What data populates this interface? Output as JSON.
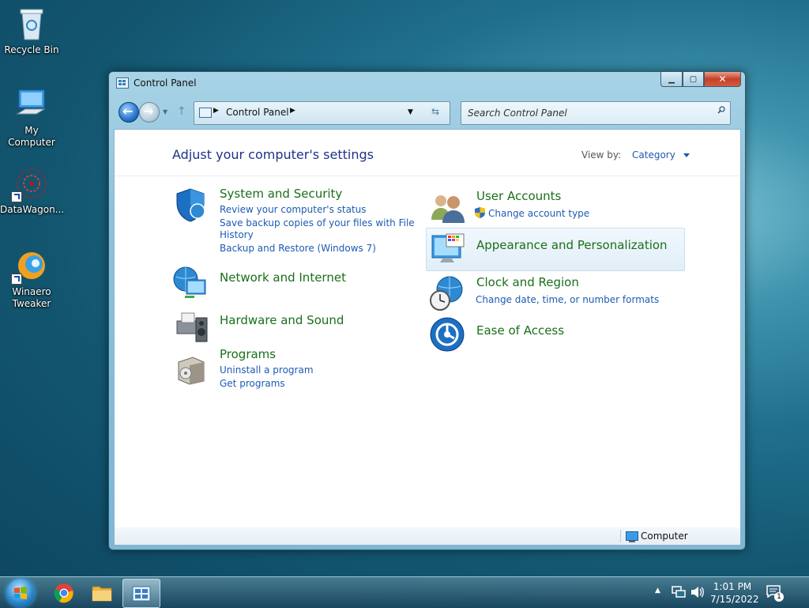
{
  "desktop": {
    "icons": [
      {
        "label": "Recycle Bin"
      },
      {
        "label": "My Computer"
      },
      {
        "label": "DataWagon..."
      },
      {
        "label": "Winaero Tweaker"
      }
    ]
  },
  "window": {
    "title": "Control Panel",
    "buttons": {
      "minimize": "▁",
      "maximize": "▢",
      "close": "✕"
    },
    "address": {
      "crumb": "Control Panel"
    },
    "search": {
      "placeholder": "Search Control Panel"
    },
    "heading": "Adjust your computer's settings",
    "view_by": {
      "label": "View by:",
      "value": "Category"
    },
    "left_categories": [
      {
        "title": "System and Security",
        "links": [
          "Review your computer's status",
          "Save backup copies of your files with File",
          "History",
          "Backup and Restore (Windows 7)"
        ]
      },
      {
        "title": "Network and Internet",
        "links": []
      },
      {
        "title": "Hardware and Sound",
        "links": []
      },
      {
        "title": "Programs",
        "links": [
          "Uninstall a program",
          "Get programs"
        ]
      }
    ],
    "right_categories": [
      {
        "title": "User Accounts",
        "links": [
          "Change account type"
        ]
      },
      {
        "title": "Appearance and Personalization",
        "links": []
      },
      {
        "title": "Clock and Region",
        "links": [
          "Change date, time, or number formats"
        ]
      },
      {
        "title": "Ease of Access",
        "links": []
      }
    ],
    "status": "Computer"
  },
  "taskbar": {
    "clock_time": "1:01 PM",
    "clock_date": "7/15/2022",
    "notification_count": "1"
  },
  "colors": {
    "category_title": "#1a6f1a",
    "link": "#1e5bb3",
    "heading": "#1e3287"
  }
}
